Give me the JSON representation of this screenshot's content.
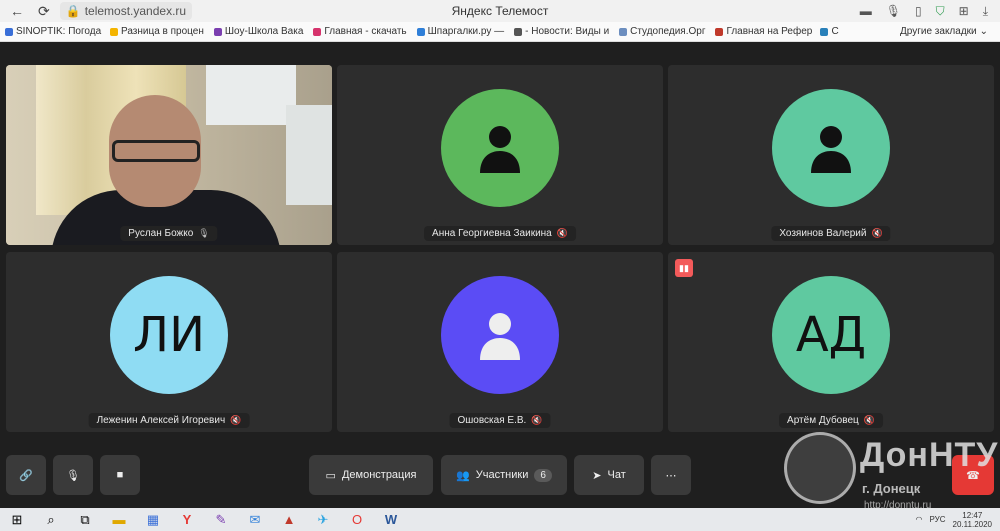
{
  "browser": {
    "url": "telemost.yandex.ru",
    "page_title": "Яндекс Телемост",
    "nav": {
      "back": "←",
      "reload": "⟳"
    },
    "bookmarks": [
      {
        "label": "SINOPTIK: Погода",
        "color": "#3a6fd8"
      },
      {
        "label": "Разница в процен",
        "color": "#f4b400"
      },
      {
        "label": "Шоу-Школа Вака",
        "color": "#7b3fb0"
      },
      {
        "label": "Главная - скачать",
        "color": "#d6336c"
      },
      {
        "label": "Шпаргалки.ру —",
        "color": "#2f7fd8"
      },
      {
        "label": "- Новости: Виды и",
        "color": "#555555"
      },
      {
        "label": "Студопедия.Орг",
        "color": "#6c8ebf"
      },
      {
        "label": "Главная на Рефер",
        "color": "#c0392b"
      },
      {
        "label": "С",
        "color": "#2980b9"
      }
    ],
    "other_bookmarks": "Другие закладки"
  },
  "participants": [
    {
      "name": "Руслан Божко",
      "type": "camera",
      "mic": "on"
    },
    {
      "name": "Анна Георгиевна Заикина",
      "type": "avatar",
      "color": "#5cb85c",
      "icon": "person-icon",
      "mic": "off"
    },
    {
      "name": "Хозяинов Валерий",
      "type": "avatar",
      "color": "#5fc9a0",
      "icon": "person-icon",
      "mic": "off"
    },
    {
      "name": "Леженин Алексей Игоревич",
      "type": "initials",
      "initials": "ЛИ",
      "color": "#8fdcf3",
      "mic": "off"
    },
    {
      "name": "Ошовская Е.В.",
      "type": "avatar",
      "color": "#5b4cf5",
      "icon": "person-icon",
      "mic": "off"
    },
    {
      "name": "Артём Дубовец",
      "type": "initials",
      "initials": "АД",
      "color": "#5fc9a0",
      "mic": "off",
      "speaking": true
    }
  ],
  "controls": {
    "screen_share": "Демонстрация",
    "participants_label": "Участники",
    "participants_count": "6",
    "chat": "Чат",
    "more": "⋯"
  },
  "watermark": {
    "title": "ДонНТУ",
    "subtitle": "г. Донецк",
    "url": "http://donntu.ru"
  },
  "taskbar": {
    "apps": [
      "start-icon",
      "search-icon",
      "task-view-icon",
      "file-explorer-icon",
      "calculator-icon",
      "yandex-browser-icon",
      "paint-icon",
      "mail-icon",
      "chart-icon",
      "telegram-icon",
      "opera-icon",
      "word-icon"
    ],
    "lang": "РУС",
    "time": "12:47",
    "date": "20.11.2020"
  }
}
